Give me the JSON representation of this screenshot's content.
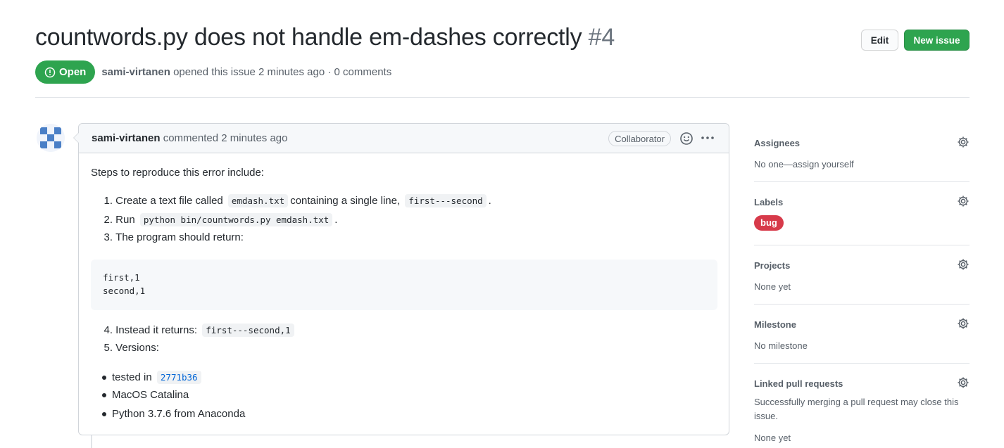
{
  "issue": {
    "title": "countwords.py does not handle em-dashes correctly",
    "number": "#4",
    "state": "Open",
    "author": "sami-virtanen",
    "opened_text": "opened this issue 2 minutes ago · 0 comments"
  },
  "header_actions": {
    "edit_label": "Edit",
    "new_issue_label": "New issue"
  },
  "comment": {
    "author": "sami-virtanen",
    "action": "commented 2 minutes ago",
    "role": "Collaborator",
    "intro": "Steps to reproduce this error include:",
    "steps": {
      "s1": {
        "num": "1.",
        "pre": "Create a text file called",
        "code1": "emdash.txt",
        "mid": "containing a single line,",
        "code2": "first---second",
        "post": "."
      },
      "s2": {
        "num": "2.",
        "pre": "Run",
        "code": "python bin/countwords.py emdash.txt",
        "post": "."
      },
      "s3": {
        "num": "3.",
        "text": "The program should return:"
      },
      "code_block_lines": [
        "first,1",
        "second,1"
      ],
      "s4": {
        "num": "4.",
        "pre": "Instead it returns:",
        "code": "first---second,1"
      },
      "s5": {
        "num": "5.",
        "text": "Versions:"
      }
    },
    "versions": {
      "v1_pre": "tested in",
      "v1_commit": "2771b36",
      "v2": "MacOS Catalina",
      "v3": "Python 3.7.6 from Anaconda"
    }
  },
  "sidebar": {
    "assignees": {
      "title": "Assignees",
      "value": "No one—assign yourself"
    },
    "labels": {
      "title": "Labels",
      "bug_label": "bug",
      "bug_color": "#d73a4a"
    },
    "projects": {
      "title": "Projects",
      "value": "None yet"
    },
    "milestone": {
      "title": "Milestone",
      "value": "No milestone"
    },
    "linked_prs": {
      "title": "Linked pull requests",
      "description": "Successfully merging a pull request may close this issue.",
      "value": "None yet"
    }
  },
  "colors": {
    "open_green": "#2ea44f",
    "link_blue": "#0366d6",
    "muted_text": "#586069"
  }
}
